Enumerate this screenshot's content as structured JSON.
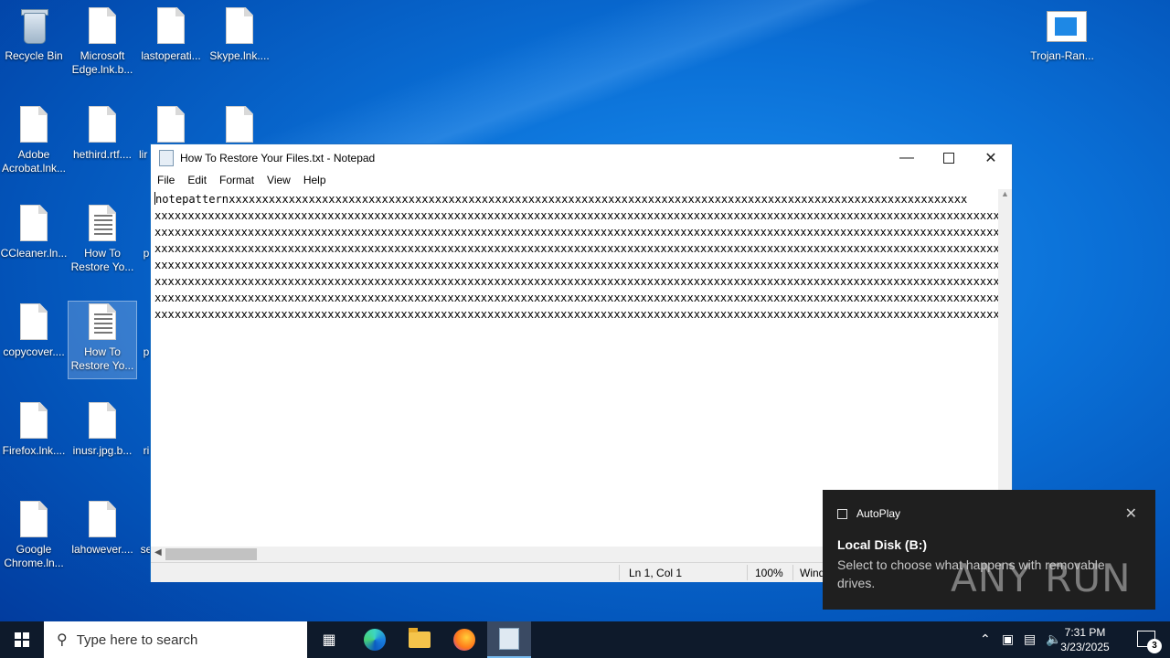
{
  "desktop": {
    "icons": [
      {
        "label": "Recycle Bin"
      },
      {
        "label": "Microsoft Edge.lnk.b..."
      },
      {
        "label": "lastoperati..."
      },
      {
        "label": "Skype.lnk...."
      },
      {
        "label": "Trojan-Ran..."
      },
      {
        "label": "Adobe Acrobat.lnk..."
      },
      {
        "label": "hethird.rtf...."
      },
      {
        "label": "lir"
      },
      {
        "label": "CCleaner.ln..."
      },
      {
        "label": "How To Restore Yo..."
      },
      {
        "label": "p"
      },
      {
        "label": "copycover...."
      },
      {
        "label": "How To Restore Yo..."
      },
      {
        "label": "p"
      },
      {
        "label": "Firefox.lnk...."
      },
      {
        "label": "inusr.jpg.b..."
      },
      {
        "label": "ri"
      },
      {
        "label": "Google Chrome.ln..."
      },
      {
        "label": "lahowever...."
      },
      {
        "label": "se"
      }
    ]
  },
  "notepad": {
    "title": "How To Restore Your Files.txt - Notepad",
    "menu": [
      "File",
      "Edit",
      "Format",
      "View",
      "Help"
    ],
    "lines": [
      "notepatternxxxxxxxxxxxxxxxxxxxxxxxxxxxxxxxxxxxxxxxxxxxxxxxxxxxxxxxxxxxxxxxxxxxxxxxxxxxxxxxxxxxxxxxxxxxxxxxxxxxxxxxxxxxxxxx",
      "xxxxxxxxxxxxxxxxxxxxxxxxxxxxxxxxxxxxxxxxxxxxxxxxxxxxxxxxxxxxxxxxxxxxxxxxxxxxxxxxxxxxxxxxxxxxxxxxxxxxxxxxxxxxxxxxxxxxxxxxxxxxxxxxx",
      "xxxxxxxxxxxxxxxxxxxxxxxxxxxxxxxxxxxxxxxxxxxxxxxxxxxxxxxxxxxxxxxxxxxxxxxxxxxxxxxxxxxxxxxxxxxxxxxxxxxxxxxxxxxxxxxxxxxxxxxxxxxxxxxx",
      "xxxxxxxxxxxxxxxxxxxxxxxxxxxxxxxxxxxxxxxxxxxxxxxxxxxxxxxxxxxxxxxxxxxxxxxxxxxxxxxxxxxxxxxxxxxxxxxxxxxxxxxxxxxxxxxxxxxxxxxxxxxxxxxx",
      "xxxxxxxxxxxxxxxxxxxxxxxxxxxxxxxxxxxxxxxxxxxxxxxxxxxxxxxxxxxxxxxxxxxxxxxxxxxxxxxxxxxxxxxxxxxxxxxxxxxxxxxxxxxxxxxxxxxxxxxxxxxxxxxx",
      "xxxxxxxxxxxxxxxxxxxxxxxxxxxxxxxxxxxxxxxxxxxxxxxxxxxxxxxxxxxxxxxxxxxxxxxxxxxxxxxxxxxxxxxxxxxxxxxxxxxxxxxxxxxxxxxxxxxxxxxxxxxxxxxx",
      "xxxxxxxxxxxxxxxxxxxxxxxxxxxxxxxxxxxxxxxxxxxxxxxxxxxxxxxxxxxxxxxxxxxxxxxxxxxxxxxxxxxxxxxxxxxxxxxxxxxxxxxxxxxxxxxxxxxxxxxxxxxxxxxx",
      "xxxxxxxxxxxxxxxxxxxxxxxxxxxxxxxxxxxxxxxxxxxxxxxxxxxxxxxxxxxxxxxxxxxxxxxxxxxxxxxxxxxxxxxxxxxxxxxxxxxxxxxxxxxxxxxxxxxxxxxxxxxxxxxx"
    ],
    "status": {
      "position": "Ln 1, Col 1",
      "zoom": "100%",
      "encoding": "Wind"
    }
  },
  "toast": {
    "app": "AutoPlay",
    "title": "Local Disk (B:)",
    "message": "Select to choose what happens with removable drives."
  },
  "watermark": "ANY RUN",
  "taskbar": {
    "search_placeholder": "Type here to search",
    "time": "7:31 PM",
    "date": "3/23/2025",
    "notification_count": "3"
  }
}
